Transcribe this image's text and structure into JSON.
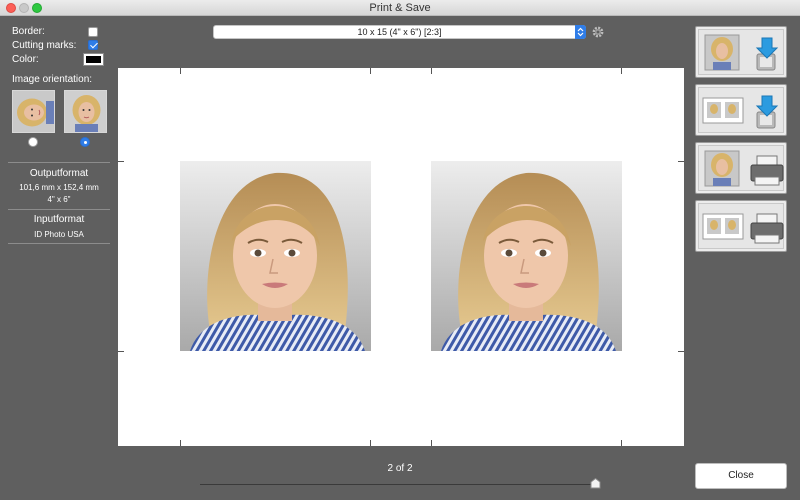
{
  "window": {
    "title": "Print & Save"
  },
  "options": {
    "border_label": "Border:",
    "border_checked": false,
    "cutting_marks_label": "Cutting marks:",
    "cutting_marks_checked": true,
    "color_label": "Color:",
    "color_value": "#000000",
    "orientation_label": "Image orientation:",
    "orientation_selected": "portrait"
  },
  "output": {
    "heading": "Outputformat",
    "size_mm": "101,6 mm x 152,4 mm",
    "size_in": "4\" x 6\""
  },
  "input": {
    "heading": "Inputformat",
    "value": "ID Photo USA"
  },
  "format_select": {
    "value": "10 x 15 (4\" x 6\") [2:3]"
  },
  "icons": {
    "settings": "gear-icon",
    "save_single": "download-icon",
    "save_sheet": "download-icon",
    "print_single": "printer-icon",
    "print_sheet": "printer-icon"
  },
  "pagination": {
    "label": "2 of 2",
    "current": 2,
    "total": 2
  },
  "close_label": "Close",
  "colors": {
    "accent": "#2f7de8",
    "background": "#5f5f5f",
    "paper": "#ffffff"
  }
}
